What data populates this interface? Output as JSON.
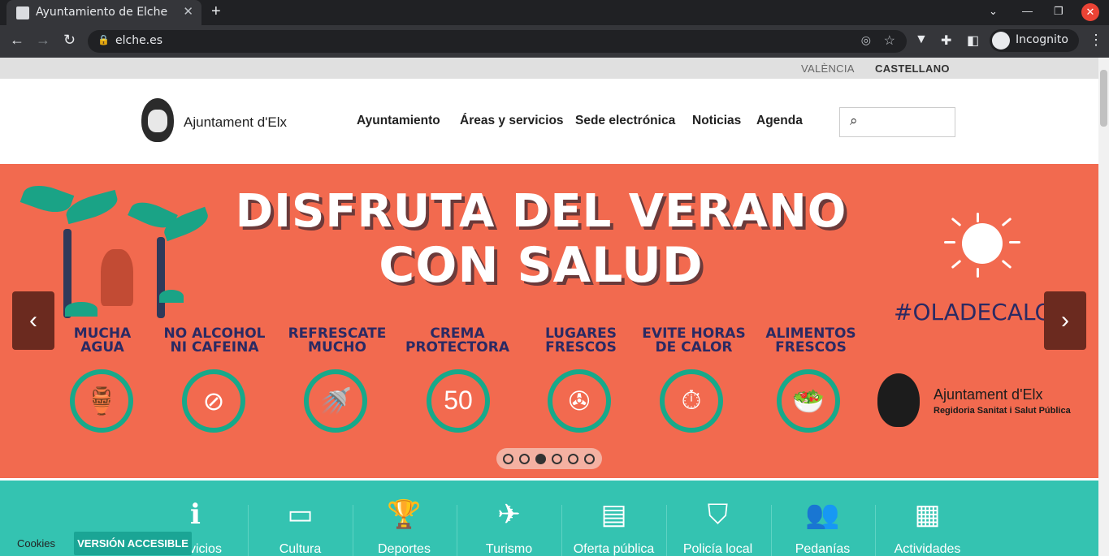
{
  "browser": {
    "tab_title": "Ayuntamiento de Elche",
    "tab_close": "✕",
    "new_tab": "+",
    "url": "elche.es",
    "incognito_label": "Incognito",
    "win_min": "—",
    "win_restore": "❐",
    "win_close": "✕"
  },
  "lang": {
    "valencia": "VALÈNCIA",
    "castellano": "CASTELLANO"
  },
  "header": {
    "logo_text": "Ajuntament d'Elx",
    "nav": [
      "Ayuntamiento",
      "Áreas y servicios",
      "Sede electrónica",
      "Noticias",
      "Agenda"
    ],
    "search_placeholder": ""
  },
  "slide": {
    "headline1": "DISFRUTA DEL VERANO",
    "headline2": "CON SALUD",
    "hashtag": "#OLADECALOR",
    "tips": [
      {
        "l1": "MUCHA",
        "l2": "AGUA",
        "icon": "water-jug-icon",
        "glyph": "🏺"
      },
      {
        "l1": "NO ALCOHOL",
        "l2": "NI CAFEINA",
        "icon": "no-alcohol-icon",
        "glyph": "⊘"
      },
      {
        "l1": "REFRESCATE",
        "l2": "MUCHO",
        "icon": "shower-icon",
        "glyph": "🚿"
      },
      {
        "l1": "CREMA",
        "l2": "PROTECTORA",
        "icon": "sunscreen-icon",
        "glyph": "50"
      },
      {
        "l1": "LUGARES",
        "l2": "FRESCOS",
        "icon": "fan-icon",
        "glyph": "✇"
      },
      {
        "l1": "EVITE HORAS",
        "l2": "DE CALOR",
        "icon": "clock-icon",
        "glyph": "⏱"
      },
      {
        "l1": "ALIMENTOS",
        "l2": "FRESCOS",
        "icon": "salad-bowl-icon",
        "glyph": "🥗"
      }
    ],
    "brand_title": "Ajuntament d'Elx",
    "brand_sub": "Regidoria Sanitat i Salut Pública",
    "prev": "‹",
    "next": "›",
    "dots_count": 6,
    "active_dot": 3
  },
  "services": [
    {
      "icon": "info-icon",
      "glyph": "ℹ",
      "label": "Servicios"
    },
    {
      "icon": "ticket-icon",
      "glyph": "▭",
      "label": "Cultura"
    },
    {
      "icon": "trophy-icon",
      "glyph": "🏆",
      "label": "Deportes"
    },
    {
      "icon": "plane-icon",
      "glyph": "✈",
      "label": "Turismo"
    },
    {
      "icon": "contacts-icon",
      "glyph": "▤",
      "label": "Oferta pública"
    },
    {
      "icon": "shield-icon",
      "glyph": "⛉",
      "label": "Policía local"
    },
    {
      "icon": "people-icon",
      "glyph": "👥",
      "label": "Pedanías"
    },
    {
      "icon": "city-icon",
      "glyph": "▦",
      "label": "Actividades"
    }
  ],
  "cookies_label": "Cookies",
  "accessible_label": "VERSIÓN ACCESIBLE"
}
